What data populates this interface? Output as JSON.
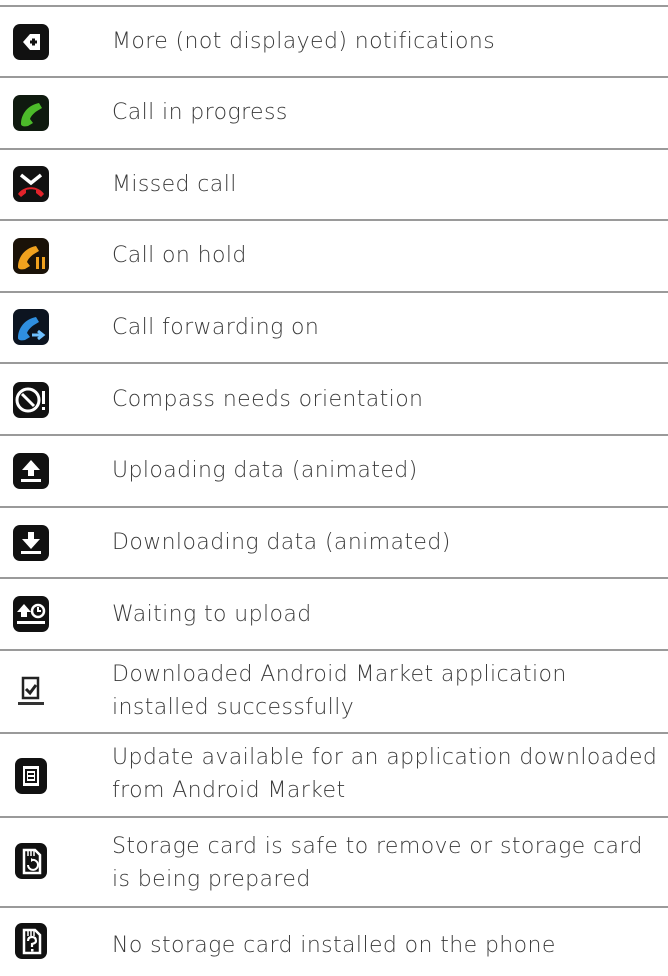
{
  "rows": [
    {
      "icon": "more-notifications-icon",
      "text": "More (not displayed) notifications"
    },
    {
      "icon": "call-in-progress-icon",
      "text": "Call in progress"
    },
    {
      "icon": "missed-call-icon",
      "text": "Missed call"
    },
    {
      "icon": "call-on-hold-icon",
      "text": "Call on hold"
    },
    {
      "icon": "call-forwarding-icon",
      "text": "Call forwarding on"
    },
    {
      "icon": "compass-icon",
      "text": "Compass needs orientation"
    },
    {
      "icon": "upload-icon",
      "text": "Uploading data (animated)"
    },
    {
      "icon": "download-icon",
      "text": "Downloading data (animated)"
    },
    {
      "icon": "waiting-upload-icon",
      "text": "Waiting to upload"
    },
    {
      "icon": "market-installed-icon",
      "text": "Downloaded Android Market application installed successfully"
    },
    {
      "icon": "market-update-icon",
      "text": "Update available for an application downloaded from Android Market"
    },
    {
      "icon": "storage-card-safe-icon",
      "text": "Storage card is safe to remove or storage card is being prepared"
    },
    {
      "icon": "no-storage-card-icon",
      "text": "No storage card installed on the phone"
    }
  ]
}
